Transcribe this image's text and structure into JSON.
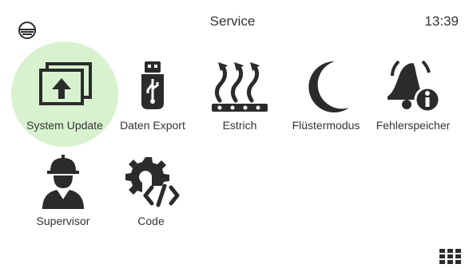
{
  "header": {
    "title": "Service",
    "time": "13:39"
  },
  "tiles": [
    {
      "label": "System Update",
      "icon": "system-update-icon",
      "selected": true
    },
    {
      "label": "Daten Export",
      "icon": "usb-icon"
    },
    {
      "label": "Estrich",
      "icon": "floor-heating-icon"
    },
    {
      "label": "Flüstermodus",
      "icon": "moon-icon"
    },
    {
      "label": "Fehlerspeicher",
      "icon": "bell-info-icon"
    },
    {
      "label": "Supervisor",
      "icon": "worker-icon"
    },
    {
      "label": "Code",
      "icon": "gear-code-icon"
    }
  ],
  "colors": {
    "icon": "#2b2b2b",
    "selected_bg": "#d8f2cf"
  }
}
